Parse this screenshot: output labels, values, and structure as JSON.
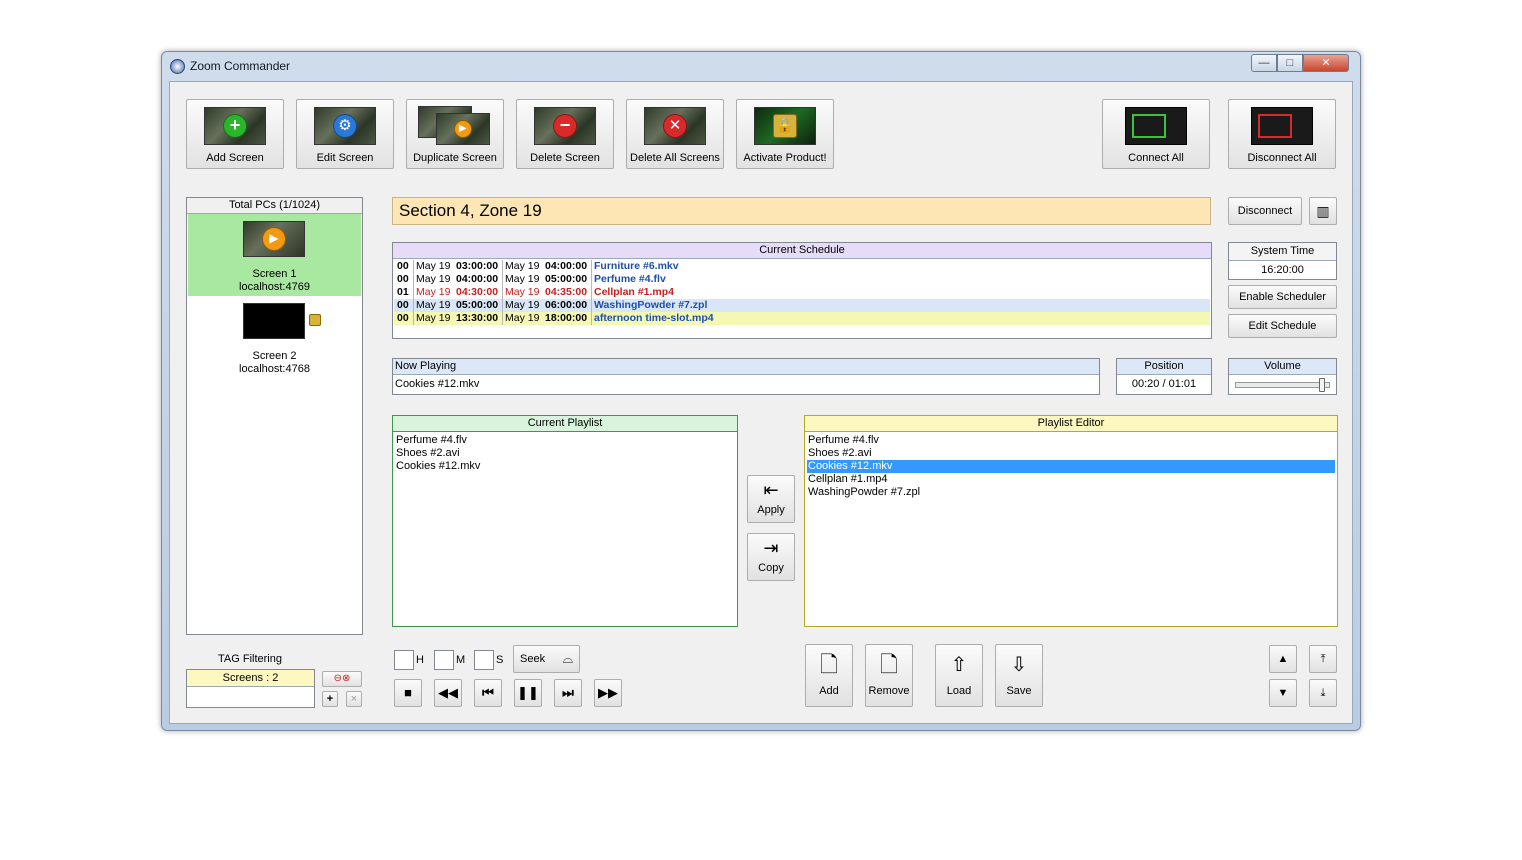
{
  "window": {
    "title": "Zoom Commander",
    "min": "—",
    "max": "□",
    "close": "✕"
  },
  "toolbar": {
    "add_screen": "Add Screen",
    "edit_screen": "Edit Screen",
    "duplicate_screen": "Duplicate Screen",
    "delete_screen": "Delete Screen",
    "delete_all_screens": "Delete All Screens",
    "activate_product": "Activate Product!",
    "connect_all": "Connect All",
    "disconnect_all": "Disconnect All"
  },
  "left_panel": {
    "header": "Total PCs (1/1024)",
    "screens": [
      {
        "name": "Screen 1",
        "host": "localhost:4769",
        "selected": true
      },
      {
        "name": "Screen 2",
        "host": "localhost:4768",
        "selected": false
      }
    ],
    "tag_filtering_label": "TAG Filtering",
    "screens_count": "Screens : 2",
    "tag_add": "+",
    "tag_remove": "×"
  },
  "zone_title": "Section 4, Zone 19",
  "disconnect_label": "Disconnect",
  "schedule": {
    "header": "Current Schedule",
    "rows": [
      {
        "ch": "00",
        "sd": "May 19",
        "st": "03:00:00",
        "ed": "May 19",
        "et": "04:00:00",
        "file": "Furniture #6.mkv",
        "color": "#1f4fa8",
        "bg": "#ffffff"
      },
      {
        "ch": "00",
        "sd": "May 19",
        "st": "04:00:00",
        "ed": "May 19",
        "et": "05:00:00",
        "file": "Perfume #4.flv",
        "color": "#1f4fa8",
        "bg": "#ffffff"
      },
      {
        "ch": "01",
        "sd": "May 19",
        "st": "04:30:00",
        "ed": "May 19",
        "et": "04:35:00",
        "file": "Cellplan #1.mp4",
        "color": "#c81e1e",
        "bg": "#ffffff"
      },
      {
        "ch": "00",
        "sd": "May 19",
        "st": "05:00:00",
        "ed": "May 19",
        "et": "06:00:00",
        "file": "WashingPowder #7.zpl",
        "color": "#1f4fa8",
        "bg": "#d8e6f8"
      },
      {
        "ch": "00",
        "sd": "May 19",
        "st": "13:30:00",
        "ed": "May 19",
        "et": "18:00:00",
        "file": "afternoon time-slot.mp4",
        "color": "#1f4fa8",
        "bg": "#f4f8b2"
      }
    ]
  },
  "system_time": {
    "label": "System Time",
    "value": "16:20:00"
  },
  "enable_scheduler": "Enable Scheduler",
  "edit_schedule": "Edit Schedule",
  "now_playing": {
    "label": "Now Playing",
    "value": "Cookies #12.mkv"
  },
  "position": {
    "label": "Position",
    "value": "00:20 / 01:01"
  },
  "volume": {
    "label": "Volume",
    "level": 0.98
  },
  "current_playlist": {
    "header": "Current Playlist",
    "items": [
      "Perfume #4.flv",
      "Shoes #2.avi",
      "Cookies #12.mkv"
    ]
  },
  "playlist_editor": {
    "header": "Playlist Editor",
    "items": [
      "Perfume #4.flv",
      "Shoes #2.avi",
      "Cookies #12.mkv",
      "Cellplan #1.mp4",
      "WashingPowder #7.zpl"
    ],
    "selected_index": 2
  },
  "apply_label": "Apply",
  "copy_label": "Copy",
  "seek": {
    "h": "H",
    "m": "M",
    "s": "S",
    "label": "Seek"
  },
  "editor_buttons": {
    "add": "Add",
    "remove": "Remove",
    "load": "Load",
    "save": "Save"
  },
  "colors": {
    "accent": "#3399ff",
    "selected_screen": "#a8e8a0",
    "zone_bg": "#fde6b4",
    "schedule_hdr": "#e6dcf8",
    "playlist_hdr": "#d8f4dc",
    "editor_hdr": "#fcf8c0",
    "info_hdr": "#dce8f8"
  }
}
